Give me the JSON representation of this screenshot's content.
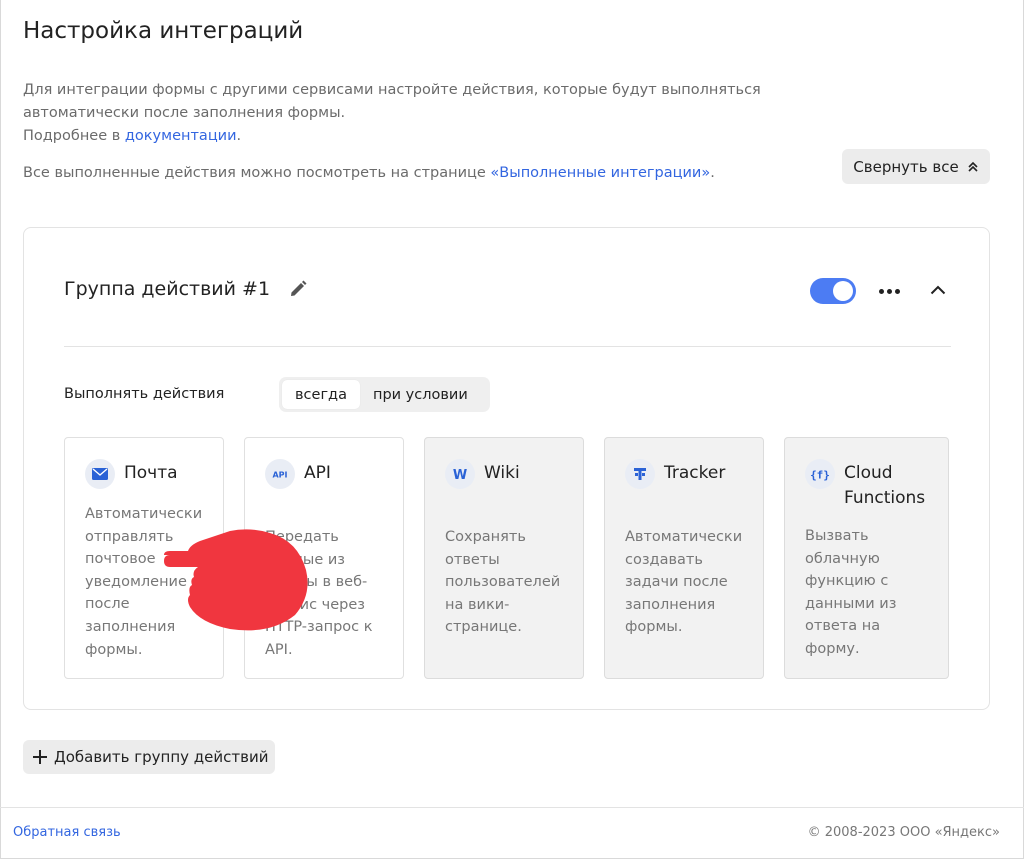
{
  "page": {
    "title": "Настройка интеграций",
    "desc_line1": "Для интеграции формы с другими сервисами настройте действия, которые будут выполняться автоматически после заполнения формы.",
    "desc_more_prefix": "Подробнее в ",
    "desc_more_link": "документации",
    "desc_more_suffix": ".",
    "history_prefix": "Все выполненные действия можно посмотреть на странице ",
    "history_link": "«Выполненные интеграции»",
    "history_suffix": ".",
    "collapse_all": "Свернуть все"
  },
  "group": {
    "title": "Группа действий #1",
    "enabled": true,
    "exec_label": "Выполнять действия",
    "modes": [
      {
        "label": "всегда",
        "active": true
      },
      {
        "label": "при условии",
        "active": false
      }
    ],
    "services": [
      {
        "name": "Почта",
        "icon": "mail-icon",
        "desc": "Автоматически отправлять почтовое уведомление после заполнения формы.",
        "disabled": false
      },
      {
        "name": "API",
        "icon": "api-icon",
        "desc": "Передать данные из формы в веб-сервис через HTTP-запрос к API.",
        "disabled": false
      },
      {
        "name": "Wiki",
        "icon": "wiki-icon",
        "desc": "Сохранять ответы пользователей на вики-странице.",
        "disabled": true
      },
      {
        "name": "Tracker",
        "icon": "tracker-icon",
        "desc": "Автоматически создавать задачи после заполнения формы.",
        "disabled": true
      },
      {
        "name": "Cloud Functions",
        "icon": "cloud-functions-icon",
        "desc": "Вызвать облачную функцию с данными из ответа на форму.",
        "disabled": true
      }
    ]
  },
  "actions": {
    "add_group": "Добавить группу действий"
  },
  "footer": {
    "feedback": "Обратная связь",
    "copyright": "© 2008-2023  ООО «Яндекс»"
  },
  "colors": {
    "accent": "#4c7cf3",
    "link": "#3366e0",
    "cursor": "#f0363f"
  }
}
